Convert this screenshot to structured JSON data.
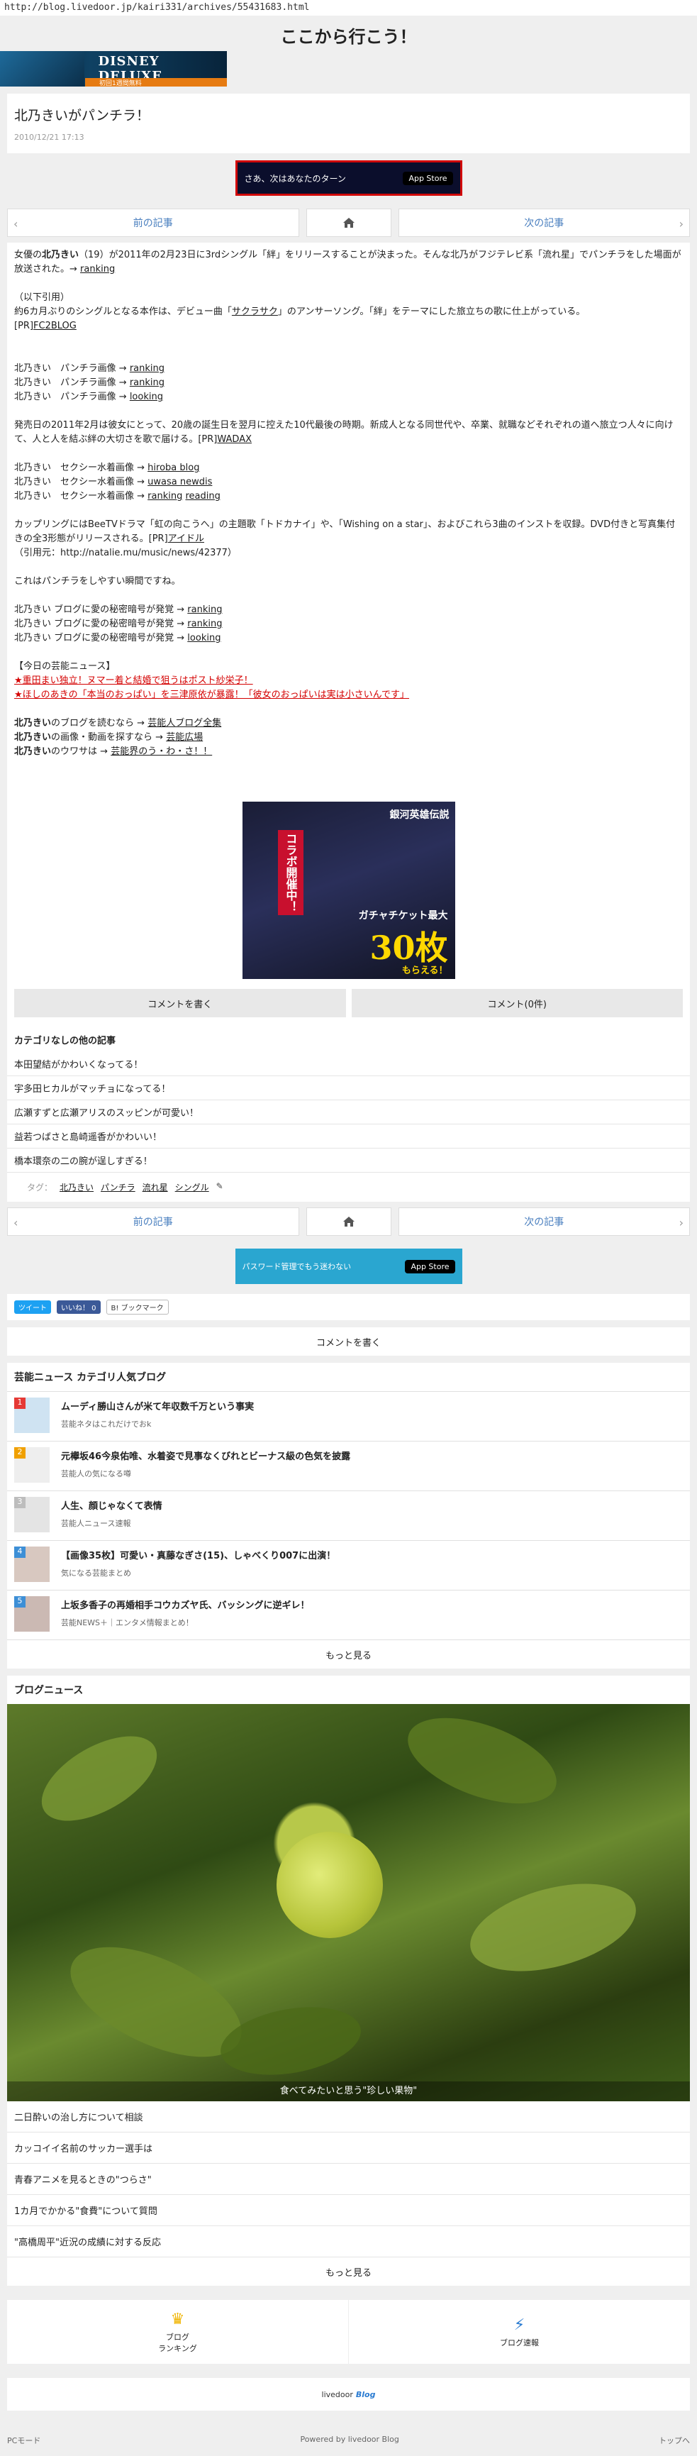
{
  "url": "http://blog.livedoor.jp/kairi331/archives/55431683.html",
  "site_title": "ここから行こう！",
  "top_banner": {
    "logo": "DISNEY DELUXE",
    "strip": "初回1週間無料"
  },
  "article": {
    "title": "北乃きいがパンチラ！",
    "date": "2010/12/21 17:13"
  },
  "ad1": {
    "text": "さあ、次はあなたのターン",
    "store": "App Store"
  },
  "pager": {
    "prev": "前の記事",
    "next": "次の記事",
    "home_icon": "home-icon"
  },
  "body": {
    "p1a": "女優の",
    "p1b": "北乃きい",
    "p1c": "（19）が2011年の2月23日に3rdシングル「絆」をリリースすることが決まった。そんな北乃がフジテレビ系「流れ星」でパンチラをした場面が放送された。→ ",
    "p1link": "ranking",
    "p2a": "（以下引用）",
    "p2b": "約6カ月ぶりのシングルとなる本作は、デビュー曲「",
    "p2link": "サクラサク",
    "p2c": "」のアンサーソング。「絆」をテーマにした旅立ちの歌に仕上がっている。",
    "p2d": "[PR]",
    "p2dlink": "FC2BLOG",
    "lines1": [
      {
        "text": "北乃きい　パンチラ画像 → ",
        "link": "ranking"
      },
      {
        "text": "北乃きい　パンチラ画像 → ",
        "link": "ranking"
      },
      {
        "text": "北乃きい　パンチラ画像 → ",
        "link": "looking"
      }
    ],
    "p3": "発売日の2011年2月は彼女にとって、20歳の誕生日を翌月に控えた10代最後の時期。新成人となる同世代や、卒業、就職などそれぞれの道へ旅立つ人々に向けて、人と人を結ぶ絆の大切さを歌で届ける。[PR]",
    "p3link": "WADAX",
    "lines2": [
      {
        "text": "北乃きい　セクシー水着画像 → ",
        "link": "hiroba blog"
      },
      {
        "text": "北乃きい　セクシー水着画像 → ",
        "link": "uwasa newdis"
      },
      {
        "text": "北乃きい　セクシー水着画像 → ",
        "link": "ranking",
        "link2": "reading"
      }
    ],
    "p4": "カップリングにはBeeTVドラマ「虹の向こうへ」の主題歌「トドカナイ」や、「Wishing on a star」、およびこれら3曲のインストを収録。DVD付きと写真集付きの全3形態がリリースされる。[PR]",
    "p4link": "アイドル",
    "p4src": "（引用元：http://natalie.mu/music/news/42377）",
    "p5": "これはパンチラをしやすい瞬間ですね。",
    "lines3": [
      {
        "text": "北乃きい ブログに愛の秘密暗号が発覚 → ",
        "link": "ranking"
      },
      {
        "text": "北乃きい ブログに愛の秘密暗号が発覚 → ",
        "link": "ranking"
      },
      {
        "text": "北乃きい ブログに愛の秘密暗号が発覚 → ",
        "link": "looking"
      }
    ],
    "news_head": "【今日の芸能ニュース】",
    "news": [
      "★重田まい独立！ヌマー着と結婚で狙うはポスト紗栄子！",
      "★ほしのあきの「本当のおっぱい」を三津原依が暴露！「彼女のおっぱいは実は小さいんです」"
    ],
    "refs": [
      {
        "name": "北乃きい",
        "text": "のブログを読むなら → ",
        "link": "芸能人ブログ全集"
      },
      {
        "name": "北乃きい",
        "text": "の画像・動画を探すなら → ",
        "link": "芸能広場"
      },
      {
        "name": "北乃きい",
        "text": "のウワサは → ",
        "link": "芸能界のう・わ・さ！！"
      }
    ]
  },
  "ad2": {
    "title": "銀河英雄伝説",
    "collab": "コラボ開催中！",
    "gacha": "ガチャチケット最大",
    "num": "30枚",
    "suffix": "もらえる！"
  },
  "actions": {
    "write": "コメントを書く",
    "count": "コメント(0件)"
  },
  "other_h": "カテゴリなしの他の記事",
  "other_items": [
    "本田望結がかわいくなってる！",
    "宇多田ヒカルがマッチョになってる！",
    "広瀬すずと広瀬アリスのスッピンが可愛い！",
    "益若つばさと島崎遥香がかわいい！",
    "橋本環奈の二の腕が逞しすぎる！"
  ],
  "tags": {
    "label": "タグ：",
    "items": [
      "北乃きい",
      "パンチラ",
      "流れ星",
      "シングル"
    ]
  },
  "ad3": {
    "text": "パスワード管理でもう迷わない",
    "store": "App Store"
  },
  "social": {
    "tweet": "ツイート",
    "like": "いいね！ 0",
    "hatena": "B! ブックマーク"
  },
  "comment_write": "コメントを書く",
  "ranking": {
    "title": "芸能ニュース カテゴリ人気ブログ",
    "items": [
      {
        "num": "1",
        "title": "ムーディ勝山さんが米て年収数千万という事実",
        "sub": "芸能ネタはこれだけでおk",
        "color": "#e53935"
      },
      {
        "num": "2",
        "title": "元欅坂46今泉佑唯、水着姿で見事なくびれとビーナス級の色気を披露",
        "sub": "芸能人の気になる噂",
        "color": "#f0a000"
      },
      {
        "num": "3",
        "title": "人生、顔じゃなくて表情",
        "sub": "芸能人ニュース速報",
        "color": "#9e9e9e"
      },
      {
        "num": "4",
        "title": "【画像35枚】可愛い・真藤なぎさ(15)、しゃべくり007に出演！",
        "sub": "気になる芸能まとめ",
        "color": "#3d8fd6"
      },
      {
        "num": "5",
        "title": "上坂多香子の再婚相手コウカズヤ氏、バッシングに逆ギレ！",
        "sub": "芸能NEWS＋｜エンタメ情報まとめ！",
        "color": "#3d8fd6"
      }
    ],
    "more": "もっと見る"
  },
  "blog_news": {
    "title": "ブログニュース",
    "caption": "食べてみたいと思う\"珍しい果物\"",
    "items": [
      "二日酔いの治し方について相談",
      "カッコイイ名前のサッカー選手は",
      "青春アニメを見るときの\"つらさ\"",
      "1カ月でかかる\"食費\"について質問",
      "\"高橋周平\"近況の成績に対する反応"
    ],
    "more": "もっと見る"
  },
  "footer_nav": [
    {
      "label": "ブログ\nランキング",
      "icon": "crown-icon",
      "color": "#f0b400"
    },
    {
      "label": "ブログ速報",
      "icon": "lightning-icon",
      "color": "#2a7bd1"
    }
  ],
  "brand": {
    "name": "livedoor",
    "blog": "Blog"
  },
  "bottom": {
    "left": "PCモード",
    "center": "Powered by livedoor Blog",
    "right": "トップへ"
  }
}
